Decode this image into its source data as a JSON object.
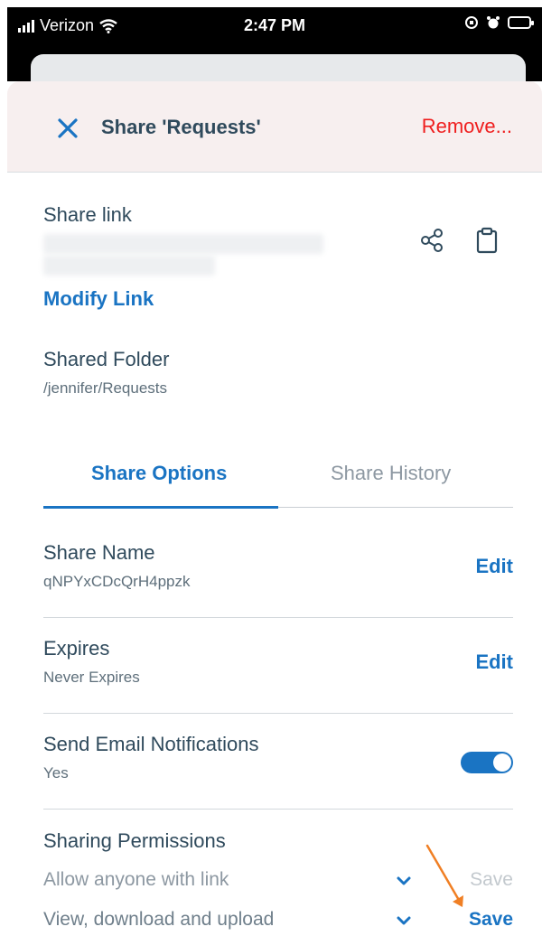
{
  "status_bar": {
    "carrier": "Verizon",
    "time": "2:47 PM"
  },
  "header": {
    "title": "Share 'Requests'",
    "remove_label": "Remove..."
  },
  "share_link": {
    "label": "Share link",
    "modify_label": "Modify Link"
  },
  "shared_folder": {
    "label": "Shared Folder",
    "path": "/jennifer/Requests"
  },
  "tabs": [
    {
      "label": "Share Options",
      "active": true
    },
    {
      "label": "Share History",
      "active": false
    }
  ],
  "options": {
    "share_name": {
      "label": "Share Name",
      "value": "qNPYxCDcQrH4ppzk",
      "action": "Edit"
    },
    "expires": {
      "label": "Expires",
      "value": "Never Expires",
      "action": "Edit"
    },
    "email_notifications": {
      "label": "Send Email Notifications",
      "value": "Yes",
      "enabled": true
    }
  },
  "permissions": {
    "title": "Sharing Permissions",
    "rows": [
      {
        "text": "Allow anyone with link",
        "save_label": "Save",
        "save_enabled": false
      },
      {
        "text": "View, download and upload",
        "save_label": "Save",
        "save_enabled": true
      }
    ]
  },
  "colors": {
    "accent": "#1a74c3",
    "danger": "#ef1e1e",
    "annotation_arrow": "#f07f24"
  }
}
